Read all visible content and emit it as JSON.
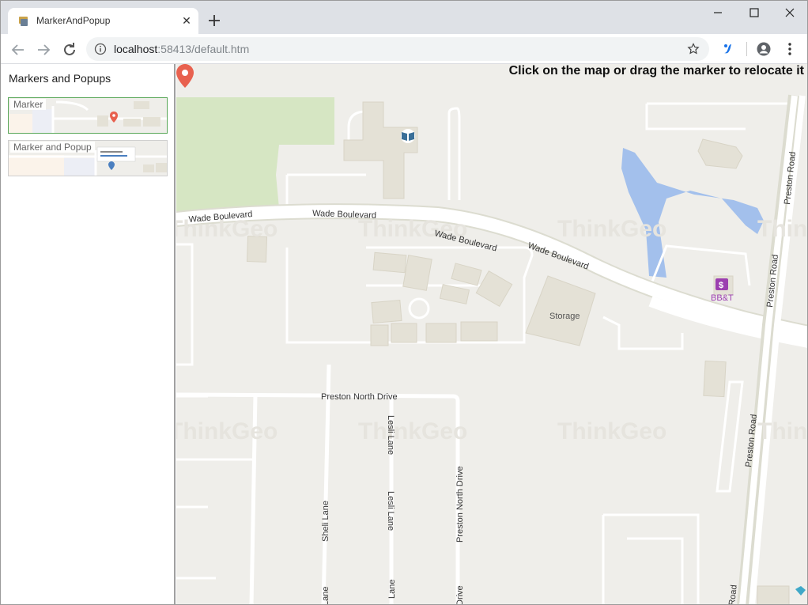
{
  "browser": {
    "tab_title": "MarkerAndPopup",
    "url_host": "localhost",
    "url_rest": ":58413/default.htm"
  },
  "sidebar": {
    "title": "Markers and Popups",
    "samples": [
      {
        "label": "Marker",
        "active": true
      },
      {
        "label": "Marker and Popup",
        "active": false
      }
    ]
  },
  "map": {
    "instruction": "Click on the map or drag the marker to relocate it",
    "labels": {
      "wade1": "Wade Boulevard",
      "wade2": "Wade Boulevard",
      "wade3": "Wade Boulevard",
      "wade4": "Wade Boulevard",
      "preston_north_drive": "Preston North Drive",
      "preston_north_drive_v": "Preston North Drive",
      "preston_north_drive_v2": "Drive",
      "lesli_lane1": "Lesli Lane",
      "lesli_lane2": "Lesli Lane",
      "lesli_lane3": "Lane",
      "sheli_lane1": "Sheli Lane",
      "sheli_lane2": "Lane",
      "preston_road1": "Preston Road",
      "preston_road2": "Preston Road",
      "preston_road3": "Preston Road",
      "preston_road4": "Road",
      "storage": "Storage",
      "bbt": "BB&T"
    },
    "watermark": "ThinkGeo",
    "colors": {
      "background": "#efeeea",
      "building": "#e4e1d6",
      "park": "#d8e8c8",
      "water": "#a4c2ee",
      "road": "#ffffff",
      "marker": "#e8614f"
    }
  }
}
